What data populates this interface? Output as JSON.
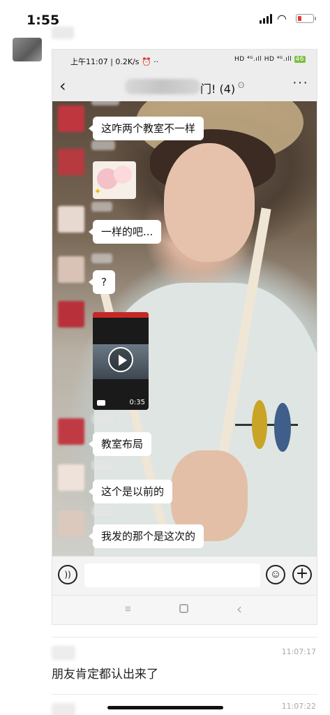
{
  "outer_status": {
    "time": "1:55",
    "wifi_icon": "wifi-icon",
    "battery_color": "#e53935"
  },
  "inner_status": {
    "left": "上午11:07 | 0.2K/s ⏰ ··",
    "right": "HD ⁴ᴳ.ıll HD ⁴ᴳ.ıll",
    "battery": "46"
  },
  "chat": {
    "back": "‹",
    "title_suffix": "门! (4)",
    "more": "···",
    "messages": [
      {
        "type": "text",
        "text": "这咋两个教室不一样"
      },
      {
        "type": "sticker"
      },
      {
        "type": "text",
        "text": "一样的吧..."
      },
      {
        "type": "text",
        "text": "?"
      },
      {
        "type": "video",
        "duration": "0:35"
      },
      {
        "type": "text",
        "text": "教室布局"
      },
      {
        "type": "text",
        "text": "这个是以前的"
      },
      {
        "type": "text",
        "text": "我发的那个是这次的"
      }
    ],
    "input": {
      "voice_icon": "voice-icon",
      "emoji_icon": "emoji-icon",
      "plus_icon": "plus-icon"
    },
    "nav": {
      "menu": "≡",
      "back": "‹"
    }
  },
  "comments": [
    {
      "time": "11:07:17",
      "text": "朋友肯定都认出来了"
    },
    {
      "time": "11:07:22",
      "text": ""
    }
  ]
}
